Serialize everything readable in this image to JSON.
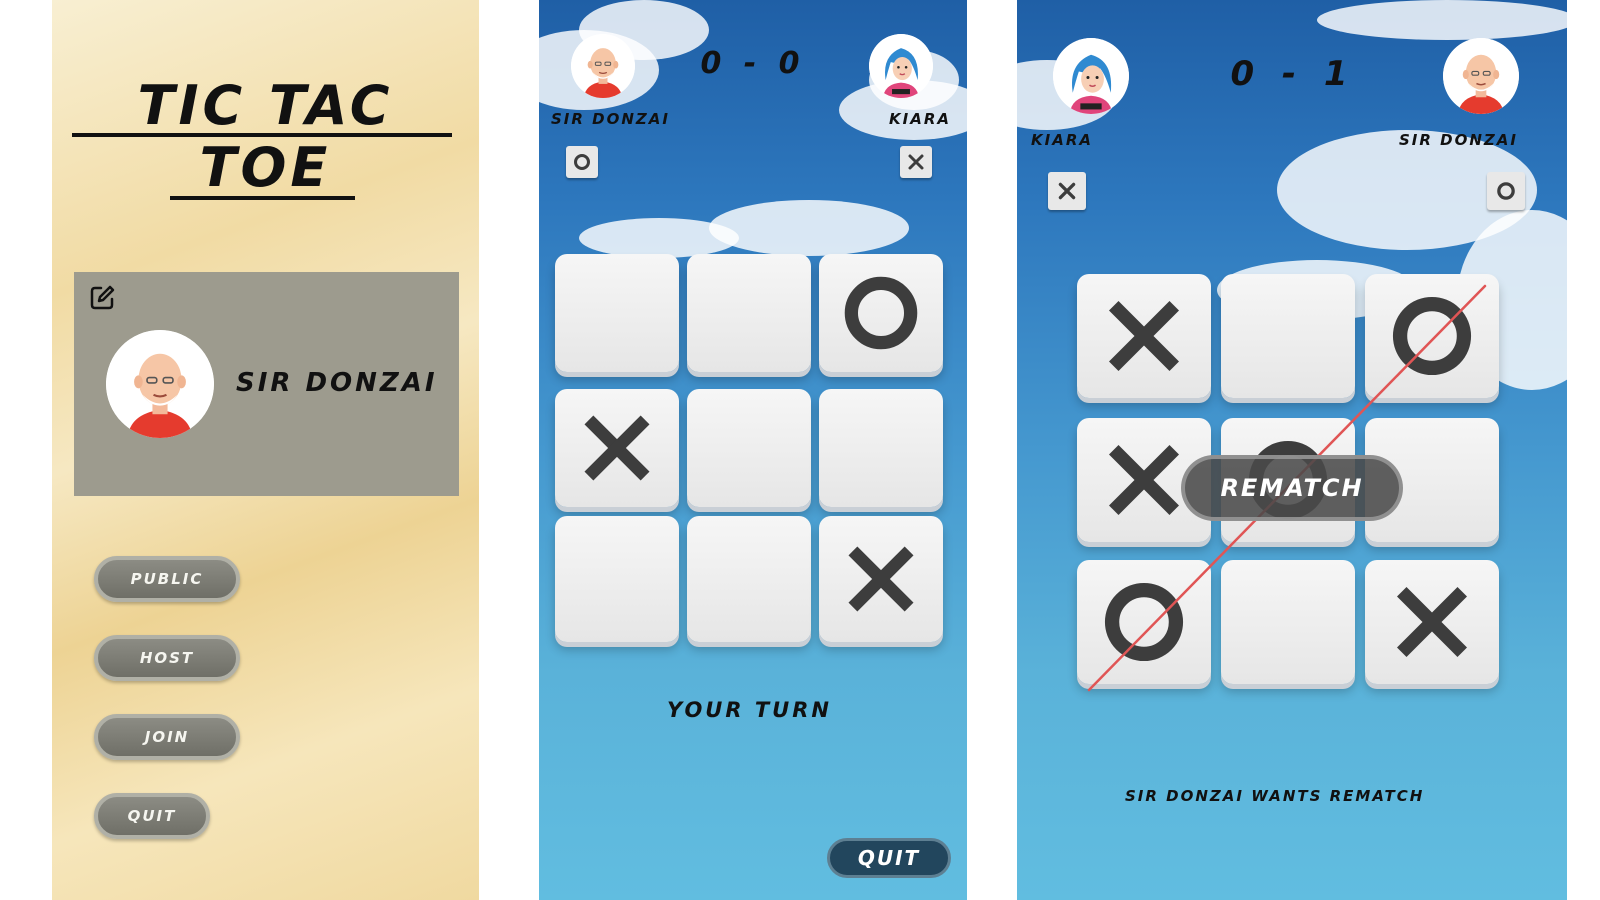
{
  "menu": {
    "title_line_1": "TIC TAC",
    "title_line_2": "TOE",
    "edit_icon": "edit-icon",
    "player_name": "SIR DONZAI",
    "avatar": "old-man-avatar",
    "buttons": [
      "PUBLIC",
      "HOST",
      "JOIN",
      "QUIT"
    ]
  },
  "game": {
    "score": "0 - 0",
    "player_left": {
      "name": "SIR DONZAI",
      "avatar": "old-man-avatar",
      "mark": "O"
    },
    "player_right": {
      "name": "KIARA",
      "avatar": "girl-avatar",
      "mark": "X"
    },
    "board": [
      "",
      "",
      "O",
      "X",
      "",
      "",
      "",
      "",
      "X"
    ],
    "status": "YOUR TURN",
    "quit_label": "QUIT"
  },
  "result": {
    "score": "0 - 1",
    "player_left": {
      "name": "KIARA",
      "avatar": "girl-avatar",
      "mark": "X"
    },
    "player_right": {
      "name": "SIR DONZAI",
      "avatar": "old-man-avatar",
      "mark": "O"
    },
    "board": [
      "X",
      "",
      "O",
      "X",
      "O",
      "",
      "O",
      "",
      "X"
    ],
    "winning_line": [
      2,
      4,
      6
    ],
    "rematch_label": "REMATCH",
    "rematch_message": "SIR DONZAI WANTS REMATCH"
  },
  "colors": {
    "sky_top": "#1f5fa6",
    "sky_bottom": "#61bde0",
    "mark": "#3d3d3d",
    "win_line": "#e05555",
    "quit_button": "#22465d"
  }
}
